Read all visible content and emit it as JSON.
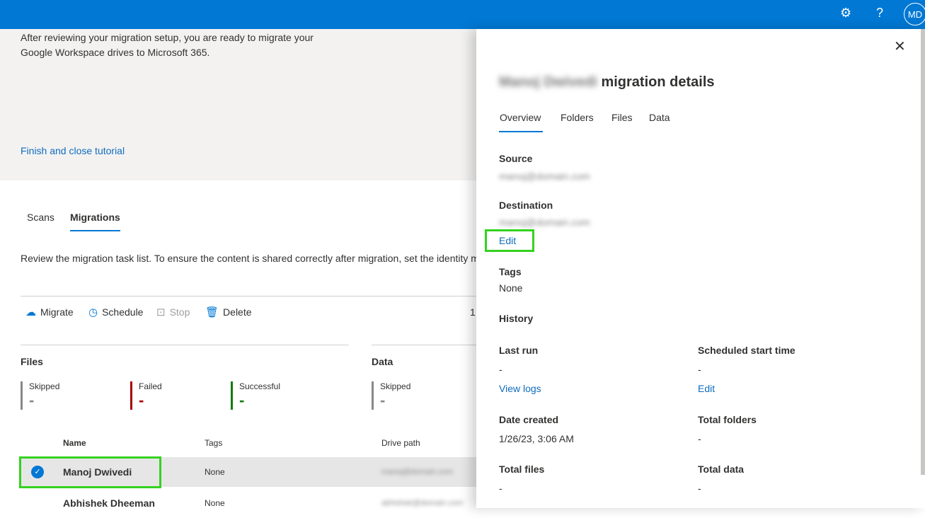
{
  "header": {
    "settings_icon": "gear-icon",
    "help_icon": "question-icon",
    "avatar_initials": "MD"
  },
  "hero": {
    "text": "After reviewing your migration setup, you are ready to migrate your Google Workspace drives to Microsoft 365.",
    "finish_link": "Finish and close tutorial"
  },
  "tabs": [
    {
      "label": "Scans"
    },
    {
      "label": "Migrations",
      "selected": true
    }
  ],
  "description": "Review the migration task list. To ensure the content is shared correctly after migration, set the identity m",
  "commands": {
    "migrate": "Migrate",
    "schedule": "Schedule",
    "stop": "Stop",
    "delete": "Delete",
    "count": "1"
  },
  "files": {
    "title": "Files",
    "skipped_label": "Skipped",
    "skipped": "-",
    "failed_label": "Failed",
    "failed": "-",
    "successful_label": "Successful",
    "successful": "-"
  },
  "data_section": {
    "title": "Data",
    "skipped_label": "Skipped",
    "skipped": "-"
  },
  "colors": {
    "skipped": "#8a8886",
    "failed": "#a80000",
    "successful": "#107c10",
    "accent": "#0078d4"
  },
  "table": {
    "columns": [
      "Name",
      "Tags",
      "Drive path"
    ],
    "rows": [
      {
        "name": "Manoj Dwivedi",
        "tags": "None",
        "drive_path": "manoj@domain.com",
        "selected": true
      },
      {
        "name": "Abhishek Dheeman",
        "tags": "None",
        "drive_path": "abhishek@domain.com"
      }
    ]
  },
  "panel": {
    "title_name": "Manoj Dwivedi",
    "title_suffix": "migration details",
    "tabs": [
      "Overview",
      "Folders",
      "Files",
      "Data"
    ],
    "source_label": "Source",
    "source_value": "manoj@domain.com",
    "destination_label": "Destination",
    "destination_value": "manoj@domain.com",
    "edit": "Edit",
    "tags_label": "Tags",
    "tags_value": "None",
    "history_label": "History",
    "last_run_label": "Last run",
    "last_run": "-",
    "view_logs": "View logs",
    "scheduled_label": "Scheduled start time",
    "scheduled": "-",
    "scheduled_edit": "Edit",
    "date_created_label": "Date created",
    "date_created": "1/26/23, 3:06 AM",
    "total_folders_label": "Total folders",
    "total_folders": "-",
    "total_files_label": "Total files",
    "total_files": "-",
    "total_data_label": "Total data",
    "total_data": "-"
  }
}
